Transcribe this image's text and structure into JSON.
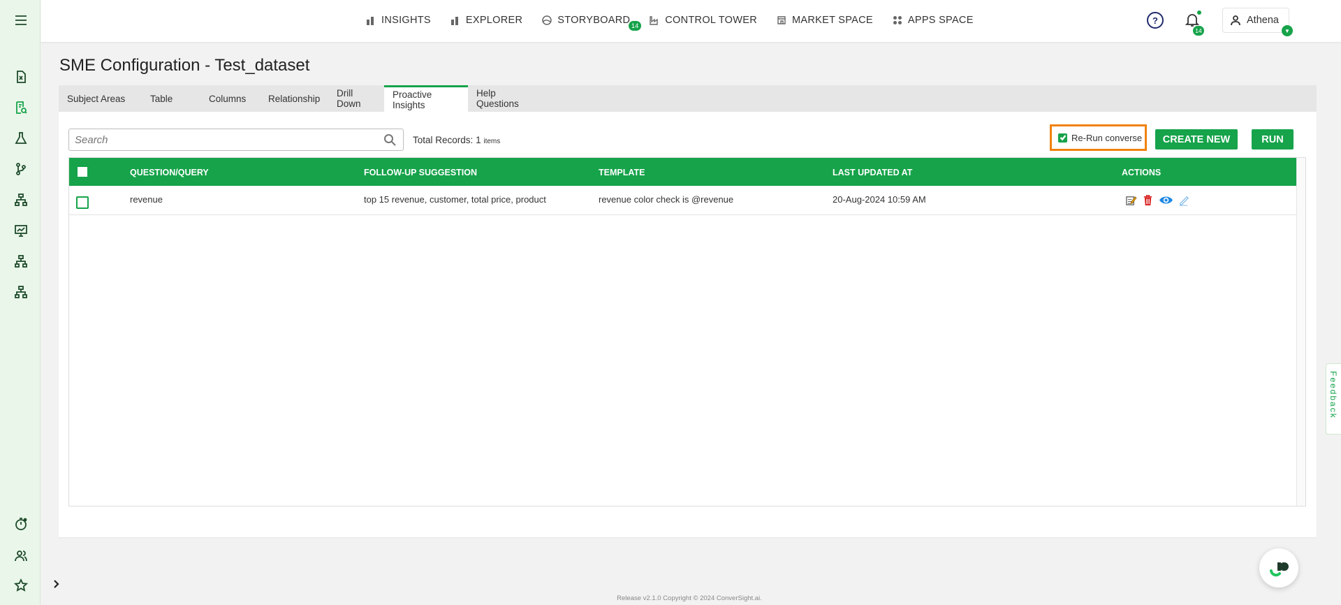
{
  "nav": {
    "items": [
      {
        "label": "INSIGHTS",
        "icon": "bar-chart-icon"
      },
      {
        "label": "EXPLORER",
        "icon": "bar-chart-icon"
      },
      {
        "label": "STORYBOARD",
        "icon": "storyboard-icon",
        "badge": "14"
      },
      {
        "label": "CONTROL TOWER",
        "icon": "factory-icon"
      },
      {
        "label": "MARKET SPACE",
        "icon": "store-icon"
      },
      {
        "label": "APPS SPACE",
        "icon": "grid-icon"
      }
    ],
    "notifications_badge": "14",
    "user_name": "Athena"
  },
  "page": {
    "title": "SME Configuration - Test_dataset",
    "tabs": [
      "Subject Areas",
      "Table",
      "Columns",
      "Relationship",
      "Drill Down",
      "Proactive Insights",
      "Help Questions"
    ],
    "active_tab": "Proactive Insights"
  },
  "toolbar": {
    "search_placeholder": "Search",
    "total_label": "Total Records:",
    "total_count": "1",
    "total_unit": "items",
    "rerun_label": "Re-Run converse",
    "rerun_checked": true,
    "create_label": "CREATE NEW",
    "run_label": "RUN"
  },
  "table": {
    "columns": [
      "QUESTION/QUERY",
      "FOLLOW-UP SUGGESTION",
      "TEMPLATE",
      "LAST UPDATED AT",
      "ACTIONS"
    ],
    "rows": [
      {
        "question": "revenue",
        "followup": "top 15 revenue, customer, total price, product",
        "template": "revenue color check is @revenue",
        "updated": "20-Aug-2024 10:59 AM",
        "actions": [
          "edit-icon",
          "delete-icon",
          "view-icon",
          "edit-secondary-icon"
        ]
      }
    ]
  },
  "feedback_label": "Feedback",
  "footer": "Release v2.1.0 Copyright © 2024 ConverSight.ai.",
  "colors": {
    "brand": "#16a34a",
    "highlight": "#f0820f",
    "delete": "#d92020",
    "view": "#1e88e5"
  }
}
